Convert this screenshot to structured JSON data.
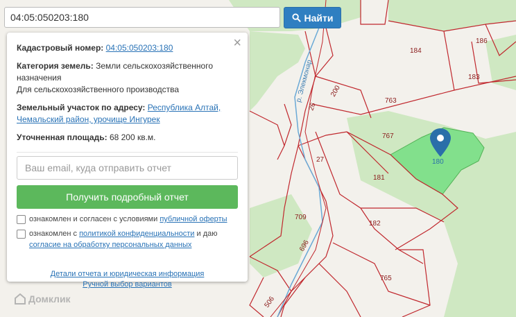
{
  "search": {
    "value": "04:05:050203:180",
    "button_label": "Найти"
  },
  "panel": {
    "cadastral_label": "Кадастровый номер:",
    "cadastral_value": "04:05:050203:180",
    "category_label": "Категория земель:",
    "category_value": "Земли сельскохозяйственного назначения",
    "category_use": "Для сельскохозяйственного производства",
    "address_label": "Земельный участок по адресу:",
    "address_value": "Республика Алтай, Чемальский район, урочище Ингурек",
    "area_label": "Уточненная площадь:",
    "area_value": "68 200 кв.м.",
    "email_placeholder": "Ваш email, куда отправить отчет",
    "report_button": "Получить подробный отчет",
    "agree1_text": "ознакомлен и согласен с условиями",
    "agree1_link": "публичной оферты",
    "agree2_text_a": "ознакомлен с",
    "agree2_link_a": "политикой конфиденциальности",
    "agree2_text_b": "и даю",
    "agree2_link_b": "согласие на обработку персональных данных",
    "details_link": "Детали отчета и юридическая информация",
    "manual_link": "Ручной выбор вариантов"
  },
  "map": {
    "labels": [
      "184",
      "186",
      "183",
      "763",
      "767",
      "180",
      "181",
      "182",
      "765",
      "709",
      "696",
      "506",
      "27",
      "26",
      "200",
      "р. Элекмонар"
    ],
    "selected_color": "#7ee08a",
    "boundary_color": "#c0272d",
    "pin_color": "#2a6fa9"
  },
  "logo": {
    "text": "Домклик"
  }
}
